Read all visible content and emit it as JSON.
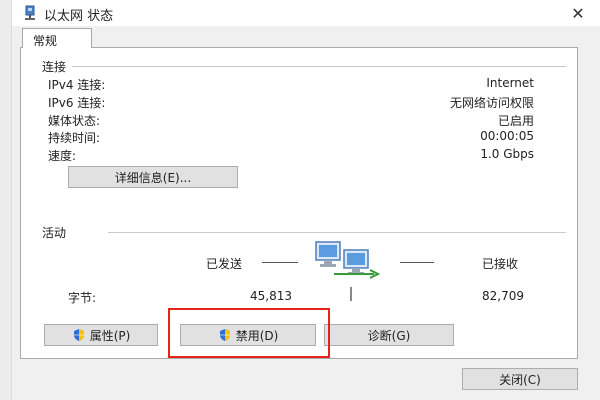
{
  "window": {
    "title": "以太网 状态",
    "close_glyph": "✕"
  },
  "tab": {
    "label": "常规"
  },
  "connection": {
    "group_title": "连接",
    "rows": [
      {
        "label": "IPv4 连接:",
        "value": "Internet"
      },
      {
        "label": "IPv6 连接:",
        "value": "无网络访问权限"
      },
      {
        "label": "媒体状态:",
        "value": "已启用"
      },
      {
        "label": "持续时间:",
        "value": "00:00:05"
      },
      {
        "label": "速度:",
        "value": "1.0 Gbps"
      }
    ],
    "details_button": "详细信息(E)..."
  },
  "activity": {
    "group_title": "活动",
    "sent_label": "已发送",
    "received_label": "已接收",
    "bytes_label": "字节:",
    "bytes_sent": "45,813",
    "bytes_received": "82,709"
  },
  "buttons": {
    "properties": "属性(P)",
    "disable": "禁用(D)",
    "diagnose": "诊断(G)",
    "close": "关闭(C)"
  },
  "colors": {
    "highlight": "#e8221b",
    "shield_blue": "#2d6fd1",
    "shield_yellow": "#f5c400"
  }
}
